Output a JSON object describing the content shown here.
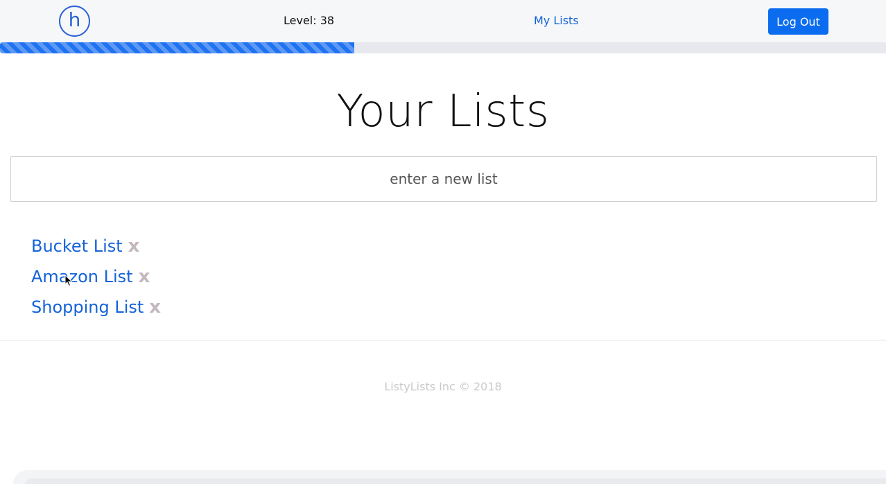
{
  "header": {
    "logo_letter": "h",
    "level_text": "Level: 38",
    "nav_link": "My Lists",
    "logout_label": "Log Out"
  },
  "progress": {
    "value": 0.4,
    "color": "#1f72f0"
  },
  "main": {
    "title": "Your Lists",
    "input_placeholder": "enter a new list",
    "lists": [
      {
        "label": "Bucket List",
        "delete": "x"
      },
      {
        "label": "Amazon List",
        "delete": "x"
      },
      {
        "label": "Shopping List",
        "delete": "x"
      }
    ]
  },
  "footer": {
    "text": "ListyLists Inc © 2018"
  },
  "colors": {
    "accent": "#0b6cf0",
    "link": "#1463d8",
    "delete": "#c4b8bf",
    "footer": "#c9c9c9"
  }
}
